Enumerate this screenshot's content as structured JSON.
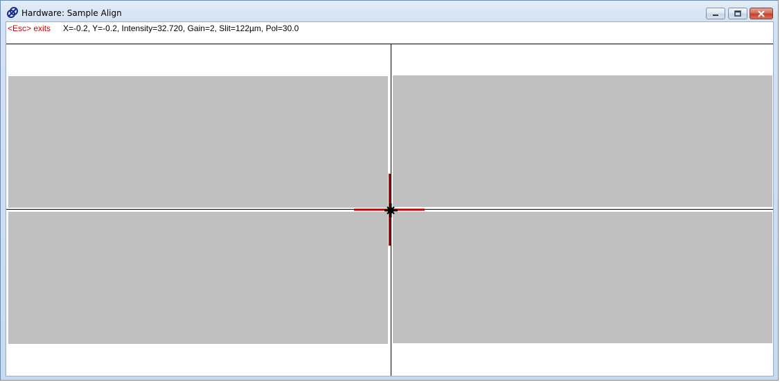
{
  "window": {
    "title": "Hardware: Sample Align",
    "app_icon": "hardware-app-icon",
    "controls": {
      "minimize": "minimize-icon",
      "maximize": "maximize-icon",
      "close": "close-icon"
    }
  },
  "status": {
    "esc_hint": "<Esc> exits",
    "readout": "X=-0.2, Y=-0.2, Intensity=32.720, Gain=2, Slit=122µm, Pol=30.0"
  },
  "view": {
    "panel_color": "#c0c0c0",
    "crosshair_color": "#c00000",
    "cursor_color": "#000000",
    "esc_color": "#d00000"
  }
}
